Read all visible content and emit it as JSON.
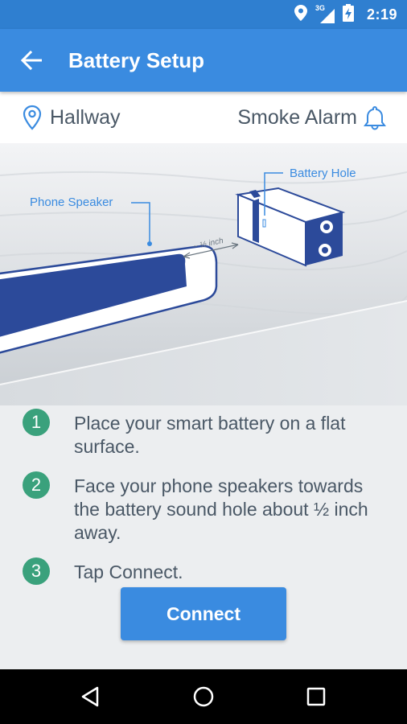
{
  "status_bar": {
    "network": "3G",
    "time": "2:19",
    "icons": [
      "location-icon",
      "signal-icon",
      "battery-charging-icon"
    ]
  },
  "app_bar": {
    "title": "Battery Setup",
    "back_icon": "arrow-left-icon"
  },
  "location_bar": {
    "location": "Hallway",
    "location_icon": "map-pin-icon",
    "device": "Smoke Alarm",
    "device_icon": "bell-icon"
  },
  "illustration": {
    "phone_label": "Phone Speaker",
    "battery_label": "Battery Hole",
    "distance_label": "~ ½ inch"
  },
  "steps": [
    {
      "number": "1",
      "text": "Place your smart battery on a flat surface."
    },
    {
      "number": "2",
      "text": "Face your phone speakers towards the battery sound hole about ½ inch away."
    },
    {
      "number": "3",
      "text": "Tap Connect."
    }
  ],
  "connect_button": {
    "label": "Connect"
  },
  "nav_bar": {
    "icons": [
      "back-triangle-icon",
      "home-circle-icon",
      "recents-square-icon"
    ]
  },
  "colors": {
    "app_bar": "#3a8be0",
    "status_bar": "#2f7fd0",
    "step_badge": "#3aa17c",
    "text": "#4a5866",
    "illustration_blue": "#2c4a9a"
  }
}
